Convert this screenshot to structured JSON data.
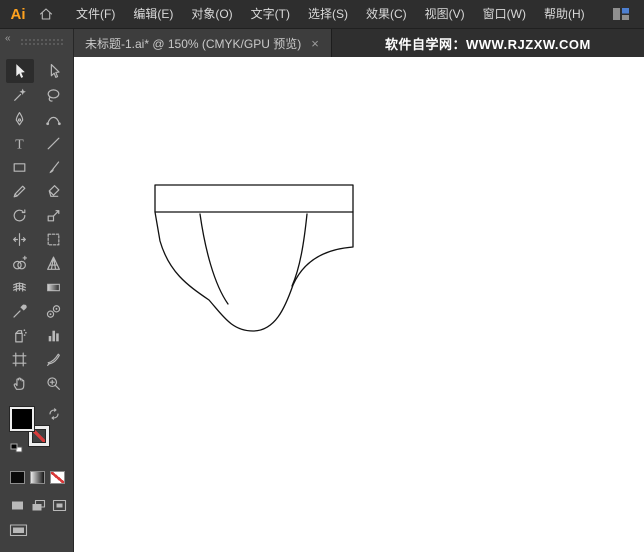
{
  "app": {
    "logo_text": "Ai",
    "watermark": "软件自学网：WWW.RJZXW.COM"
  },
  "menu_bar": {
    "items": [
      "文件(F)",
      "编辑(E)",
      "对象(O)",
      "文字(T)",
      "选择(S)",
      "效果(C)",
      "视图(V)",
      "窗口(W)",
      "帮助(H)"
    ]
  },
  "tab_bar": {
    "document_tab": {
      "title": "未标题-1.ai* @ 150% (CMYK/GPU 预览)",
      "close_glyph": "×"
    }
  },
  "toolbar": {
    "collapse_glyph": "«",
    "selected_tool": "selection",
    "tools": [
      "selection",
      "direct-selection",
      "magic-wand",
      "lasso",
      "pen",
      "curvature",
      "type",
      "line-segment",
      "rectangle",
      "paintbrush",
      "pencil",
      "eraser",
      "rotate",
      "scale",
      "width",
      "free-transform",
      "shape-builder",
      "perspective-grid",
      "mesh",
      "gradient",
      "eyedropper",
      "blend",
      "symbol-sprayer",
      "column-graph",
      "artboard",
      "slice",
      "hand",
      "zoom"
    ]
  },
  "color_controls": {
    "fill_color": "#000000",
    "stroke_style": "none",
    "none_slash_color": "#d93a3a",
    "icons": [
      "swap-colors",
      "default-colors",
      "color-button",
      "gradient-button",
      "none-button",
      "draw-normal",
      "draw-behind",
      "draw-inside",
      "screen-mode"
    ]
  },
  "canvas": {
    "artwork_description": "black outline line-art of briefs/underwear: rectangular waistband with trapezoid body curving into a U-shaped pouch, two inner leg-seam curves",
    "artwork_stroke_color": "#111111",
    "background_color": "#ffffff"
  }
}
